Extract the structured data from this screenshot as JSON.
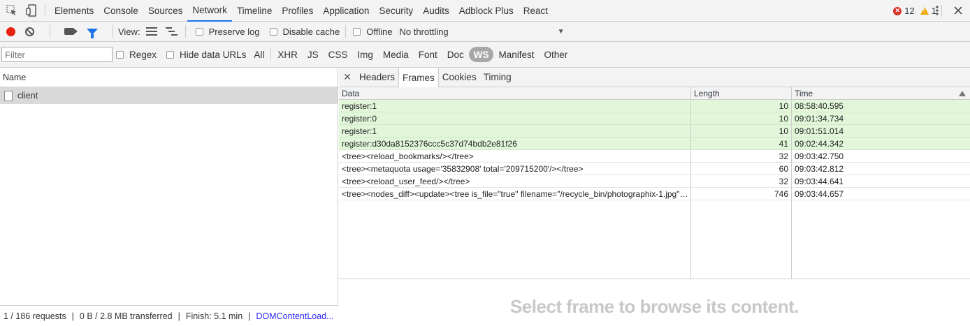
{
  "tabs": [
    "Elements",
    "Console",
    "Sources",
    "Network",
    "Timeline",
    "Profiles",
    "Application",
    "Security",
    "Audits",
    "Adblock Plus",
    "React"
  ],
  "active_tab": "Network",
  "errors": "12",
  "warnings": "1",
  "toolbar": {
    "view_label": "View:",
    "preserve_log": "Preserve log",
    "disable_cache": "Disable cache",
    "offline": "Offline",
    "throttling": "No throttling"
  },
  "filter": {
    "placeholder": "Filter",
    "regex": "Regex",
    "hide_data_urls": "Hide data URLs",
    "types": [
      "All",
      "XHR",
      "JS",
      "CSS",
      "Img",
      "Media",
      "Font",
      "Doc",
      "WS",
      "Manifest",
      "Other"
    ],
    "active_type": "WS"
  },
  "requests": {
    "header": "Name",
    "items": [
      {
        "name": "client"
      }
    ]
  },
  "status": {
    "requests": "1 / 186 requests",
    "transferred": "0 B / 2.8 MB transferred",
    "finish": "Finish: 5.1 min",
    "dom": "DOMContentLoad..."
  },
  "detail_tabs": [
    "Headers",
    "Frames",
    "Cookies",
    "Timing"
  ],
  "active_detail_tab": "Frames",
  "frames": {
    "columns": [
      "Data",
      "Length",
      "Time"
    ],
    "rows": [
      {
        "data": "register:1",
        "length": "10",
        "time": "08:58:40.595",
        "sent": true
      },
      {
        "data": "register:0",
        "length": "10",
        "time": "09:01:34.734",
        "sent": true
      },
      {
        "data": "register:1",
        "length": "10",
        "time": "09:01:51.014",
        "sent": true
      },
      {
        "data": "register:d30da8152376ccc5c37d74bdb2e81f26",
        "length": "41",
        "time": "09:02:44.342",
        "sent": true
      },
      {
        "data": "<tree><reload_bookmarks/></tree>",
        "length": "32",
        "time": "09:03:42.750",
        "sent": false
      },
      {
        "data": "<tree><metaquota usage='35832908' total='209715200'/></tree>",
        "length": "60",
        "time": "09:03:42.812",
        "sent": false
      },
      {
        "data": "<tree><reload_user_feed/></tree>",
        "length": "32",
        "time": "09:03:44.641",
        "sent": false
      },
      {
        "data": "<tree><nodes_diff><update><tree is_file=\"true\" filename=\"/recycle_bin/photographix-1.jpg\" ...",
        "length": "746",
        "time": "09:03:44.657",
        "sent": false
      }
    ]
  },
  "empty_message": "Select frame to browse its content.",
  "colors": {
    "accent": "#1a73e8",
    "record": "#e8200f",
    "sent_row": "#e2f7da",
    "selected_row": "#d9d9d9"
  }
}
